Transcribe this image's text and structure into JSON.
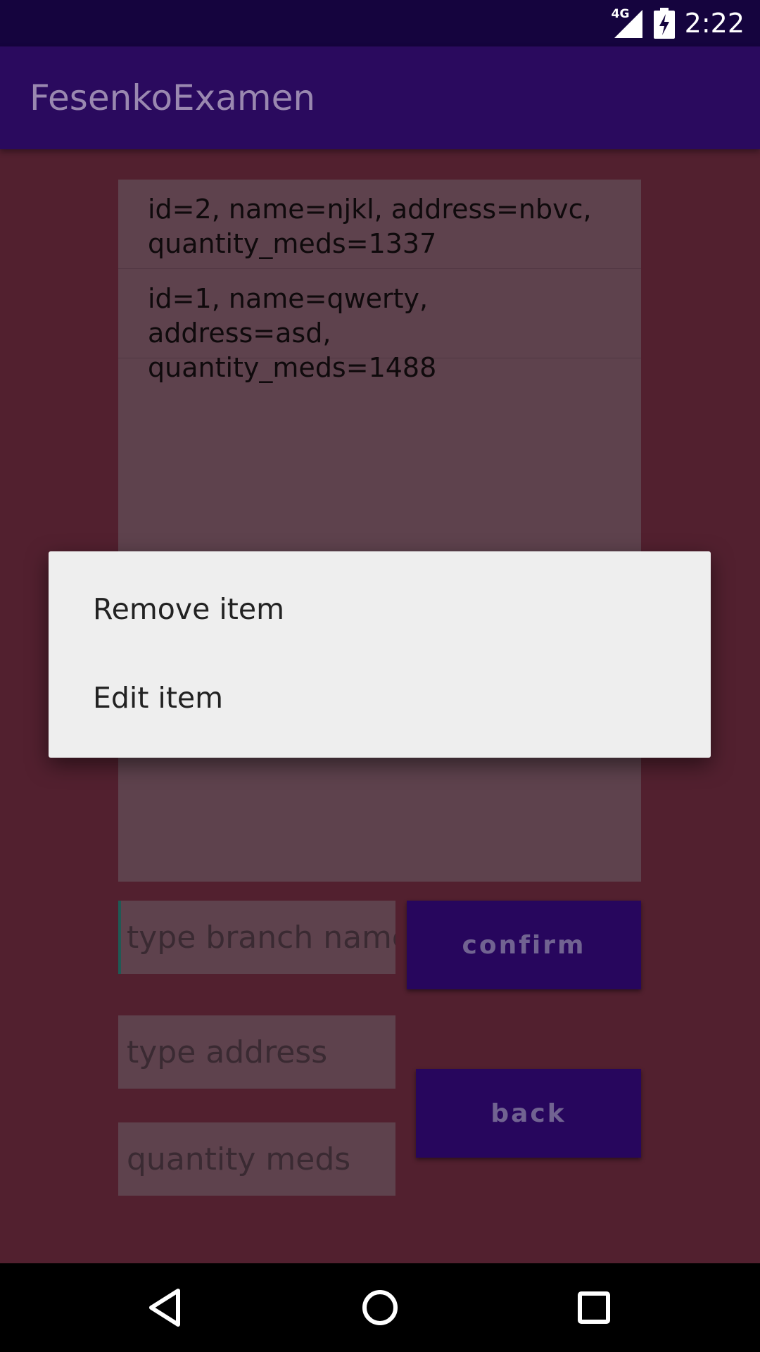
{
  "status_bar": {
    "network_type": "4G",
    "time": "2:22",
    "icons": [
      "signal-icon",
      "battery-charging-icon"
    ]
  },
  "app_bar": {
    "title": "FesenkoExamen"
  },
  "list": {
    "items": [
      {
        "text": "id=2, name=njkl, address=nbvc, quantity_meds=1337"
      },
      {
        "text": "id=1, name=qwerty, address=asd, quantity_meds=1488"
      }
    ]
  },
  "form": {
    "branch_placeholder": "type branch name",
    "address_placeholder": "type address",
    "quantity_placeholder": "quantity meds",
    "confirm_label": "confirm",
    "back_label": "back"
  },
  "context_menu": {
    "items": [
      {
        "label": "Remove item"
      },
      {
        "label": "Edit item"
      }
    ]
  },
  "nav_bar": {
    "icons": [
      "back-icon",
      "home-icon",
      "recents-icon"
    ]
  },
  "colors": {
    "status_bar": "#15043e",
    "app_bar": "#2a0a5e",
    "background": "#52202f",
    "panel": "#5e424d",
    "button": "#27065d",
    "dialog": "#eeeeee"
  }
}
